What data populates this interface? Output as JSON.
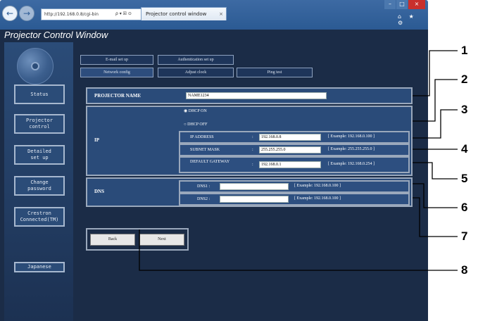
{
  "browser": {
    "back_icon": "back-arrow-icon",
    "forward_icon": "forward-arrow-icon",
    "address": "http://192.168.0.8/cgi-bin",
    "address_tools": "ρ ▾ ☒ ⊙",
    "tab_title": "Projector control window",
    "tab_close": "×",
    "ctrl_min": "–",
    "ctrl_max": "□",
    "ctrl_close": "×",
    "right_icons": "⌂ ★ ⚙"
  },
  "app_title": "Projector Control Window",
  "sidebar": {
    "items": [
      {
        "label": "Status"
      },
      {
        "label": "Projector\ncontrol"
      },
      {
        "label": "Detailed\nset up"
      },
      {
        "label": "Change\npassword"
      },
      {
        "label": "Crestron\nConnected(TM)"
      },
      {
        "label": "Japanese"
      }
    ]
  },
  "tabs": {
    "row1": [
      "E-mail set up",
      "Authentication set up"
    ],
    "row2": [
      "Network config",
      "Adjust clock",
      "Ping test"
    ]
  },
  "form": {
    "projector_name_label": "PROJECTOR NAME",
    "projector_name_value": "NAME1234",
    "ip_label": "IP",
    "dhcp_on": "DHCP ON",
    "dhcp_off": "DHCP OFF",
    "ip_address_label": "IP ADDRESS",
    "ip_address_value": "192.168.0.8",
    "ip_address_example": "[ Example: 192.168.0.100 ]",
    "subnet_label": "SUBNET MASK",
    "subnet_value": "255.255.255.0",
    "subnet_example": "[ Example: 255.255.255.0 ]",
    "gateway_label": "DEFAULT GATEWAY",
    "gateway_value": "192.168.0.1",
    "gateway_example": "[ Example: 192.168.0.254 ]",
    "colon": ":",
    "dns_label": "DNS",
    "dns1_label": "DNS1 :",
    "dns1_example": "[ Example: 192.168.0.100 ]",
    "dns2_label": "DNS2 :",
    "dns2_example": "[ Example: 192.168.0.100 ]"
  },
  "buttons": {
    "back": "Back",
    "next": "Next"
  },
  "callouts": [
    "1",
    "2",
    "3",
    "4",
    "5",
    "6",
    "7",
    "8"
  ]
}
